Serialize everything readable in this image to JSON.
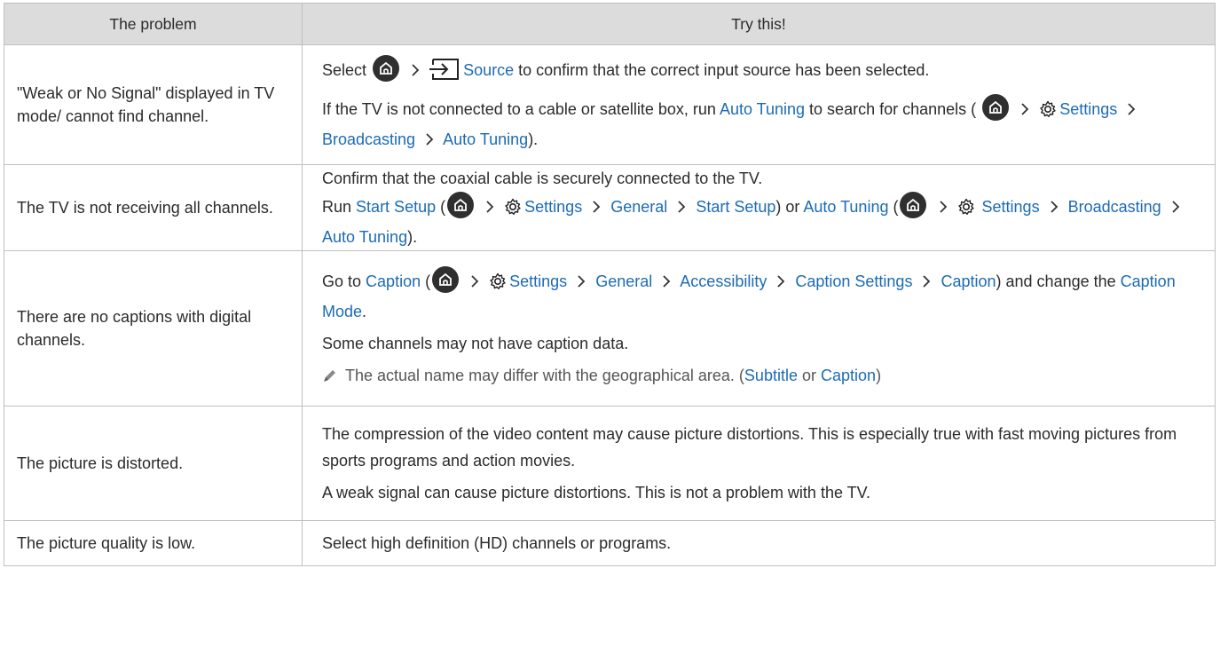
{
  "header": {
    "col1": "The problem",
    "col2": "Try this!"
  },
  "rows": [
    {
      "problem": "\"Weak or No Signal\" displayed in TV mode/ cannot find channel.",
      "s1": {
        "pre": "Select",
        "source": "Source",
        "post": "to confirm that the correct input source has been selected."
      },
      "s2": {
        "pre": "If the TV is not connected to a cable or satellite box, run",
        "auto_tuning": "Auto Tuning",
        "post": "to search for channels (",
        "settings": "Settings",
        "broadcasting": "Broadcasting",
        "auto_tuning2": "Auto Tuning",
        "end": ")."
      }
    },
    {
      "problem": "The TV is not receiving all channels.",
      "s1": "Confirm that the coaxial cable is securely connected to the TV.",
      "s2": {
        "run": "Run",
        "start_setup": "Start Setup",
        "open": "(",
        "settings": "Settings",
        "general": "General",
        "start_setup2": "Start Setup",
        "close_or": ") or",
        "auto_tuning": "Auto Tuning",
        "open2": "(",
        "settings2": "Settings",
        "broadcasting": "Broadcasting",
        "auto_tuning2": "Auto Tuning",
        "end": ")."
      }
    },
    {
      "problem": "There are no captions with digital channels.",
      "s1": {
        "goto": "Go to",
        "caption": "Caption",
        "open": "(",
        "settings": "Settings",
        "general": "General",
        "accessibility": "Accessibility",
        "caption_settings": "Caption Settings",
        "caption2": "Caption",
        "mid": ") and change the",
        "caption_mode": "Caption Mode",
        "end": "."
      },
      "s2": "Some channels may not have caption data.",
      "note": {
        "text": "The actual name may differ with the geographical area. (",
        "subtitle": "Subtitle",
        "or": "or",
        "caption": "Caption",
        "end": ")"
      }
    },
    {
      "problem": "The picture is distorted.",
      "s1": "The compression of the video content may cause picture distortions. This is especially true with fast moving pictures from sports programs and action movies.",
      "s2": "A weak signal can cause picture distortions. This is not a problem with the TV."
    },
    {
      "problem": "The picture quality is low.",
      "s1": "Select high definition (HD) channels or programs."
    }
  ],
  "icons": {
    "home": "home-icon",
    "settings": "gear-icon",
    "source": "source-input-icon",
    "chevron": "chevron-right-icon",
    "note": "pencil-note-icon"
  },
  "colors": {
    "link": "#1c6bb5",
    "header_bg": "#dcdcdc",
    "border": "#bfbfbf"
  }
}
